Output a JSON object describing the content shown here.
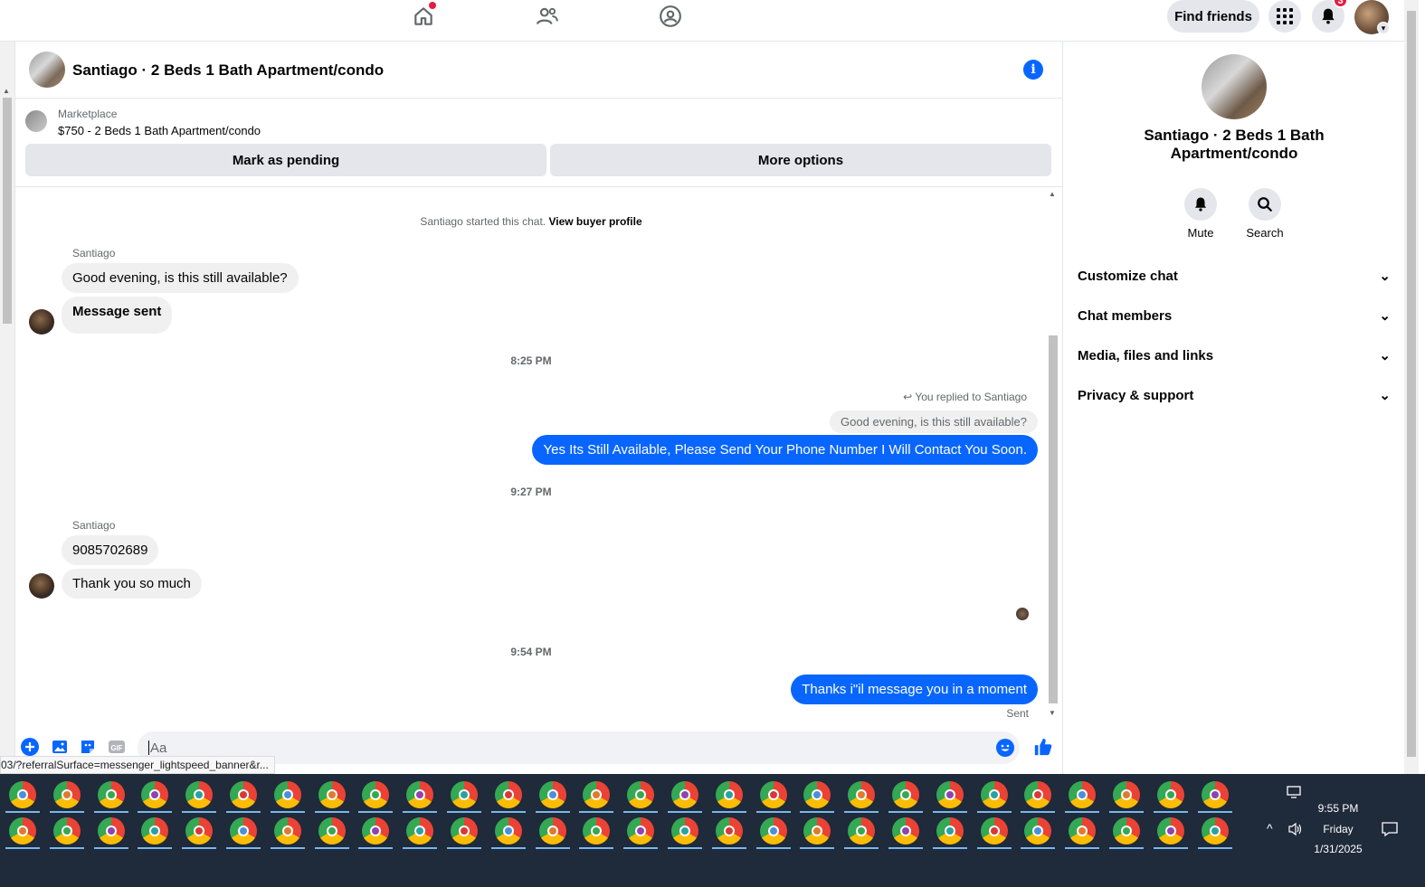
{
  "topbar": {
    "nav_icons": [
      "home-icon",
      "friends-icon",
      "groups-icon"
    ],
    "find_friends_label": "Find friends",
    "notification_count": "3"
  },
  "chat": {
    "title": "Santiago · 2 Beds 1 Bath Apartment/condo",
    "marketplace_label": "Marketplace",
    "listing": "$750 - 2 Beds 1 Bath Apartment/condo",
    "mark_pending_label": "Mark as pending",
    "more_options_label": "More options",
    "started_text": "Santiago started this chat.",
    "view_buyer_label": "View buyer profile",
    "messages": {
      "sender_1": "Santiago",
      "in_1": "Good evening, is this still available?",
      "in_2": "Message sent",
      "time_1": "8:25 PM",
      "reply_note": "You replied to Santiago",
      "reply_quote": "Good evening, is this still available?",
      "out_1": "Yes Its Still Available, Please Send Your Phone Number I Will Contact You Soon.",
      "time_2": "9:27 PM",
      "sender_2": "Santiago",
      "in_3": "9085702689",
      "in_4": "Thank you so much",
      "time_3": "9:54 PM",
      "out_2": "Thanks i\"il message you in a moment",
      "sent_label": "Sent"
    },
    "composer_placeholder": "Aa",
    "status_url": "03/?referralSurface=messenger_lightspeed_banner&r..."
  },
  "right_panel": {
    "title": "Santiago · 2 Beds 1 Bath Apartment/condo",
    "mute_label": "Mute",
    "search_label": "Search",
    "sections": [
      "Customize chat",
      "Chat members",
      "Media, files and links",
      "Privacy & support"
    ]
  },
  "taskbar": {
    "time": "9:55 PM",
    "day": "Friday",
    "date": "1/31/2025"
  },
  "colors": {
    "accent": "#0866ff",
    "bubble_in": "#f0f0f0",
    "taskbar": "#1f2a3a"
  }
}
